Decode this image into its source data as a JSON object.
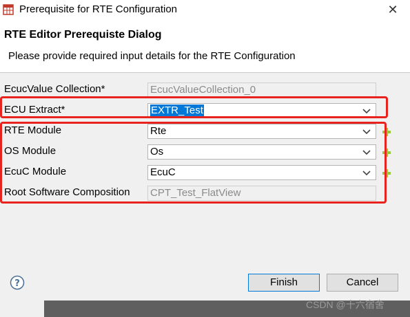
{
  "window": {
    "title": "Prerequisite for RTE Configuration",
    "app_icon": "grid-table-icon",
    "close_label": "✕"
  },
  "header": {
    "title": "RTE Editor Prerequiste Dialog",
    "description": "Please provide required input details for the RTE Configuration"
  },
  "form": {
    "ecucvalue": {
      "label": "EcucValue Collection*",
      "value": "EcucValueCollection_0"
    },
    "ecu_extract": {
      "label": "ECU Extract*",
      "value": "EXTR_Test"
    },
    "rte_module": {
      "label": "RTE Module",
      "value": "Rte"
    },
    "os_module": {
      "label": "OS Module",
      "value": "Os"
    },
    "ecuc_module": {
      "label": "EcuC Module",
      "value": "EcuC"
    },
    "root_sw": {
      "label": "Root Software Composition",
      "value": "CPT_Test_FlatView"
    }
  },
  "buttons": {
    "finish": "Finish",
    "cancel": "Cancel"
  },
  "watermark": "CSDN @十六宿舍",
  "colors": {
    "highlight": "#e8221c",
    "selection": "#0078d7",
    "add_icon": "#9bc53d"
  }
}
